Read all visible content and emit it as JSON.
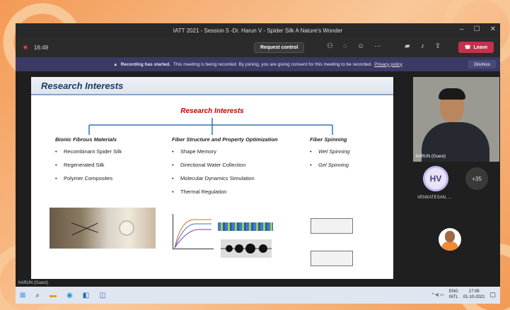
{
  "window": {
    "title": "IATT 2021 - Session 5 -Dr. Harun V - Spider Silk A Nature's Wonder"
  },
  "toolbar": {
    "time": "16:49",
    "request_control": "Request control",
    "leave": "Leave"
  },
  "banner": {
    "bold": "Recording has started.",
    "text": "This meeting is being recorded. By joining, you are giving consent for this meeting to be recorded.",
    "link": "Privacy policy",
    "dismiss": "Dismiss"
  },
  "slide": {
    "header": "Research Interests",
    "center_title": "Research Interests",
    "columns": [
      {
        "title": "Bionic Fibrous Materials",
        "items": [
          "Recombinant Spider Silk",
          "Regenerated Silk",
          "Polymer Composites"
        ]
      },
      {
        "title": "Fiber Structure and Property Optimization",
        "items": [
          "Shape Memory",
          "Directional Water Collection",
          "Molecular Dynamics Simulation",
          "Thermal Regulation"
        ]
      },
      {
        "title": "Fiber Spinning",
        "items": [
          "Wet Spinning",
          "Gel Spinning"
        ]
      }
    ]
  },
  "participants": {
    "video_label": "hARUN (Guest)",
    "hv_initials": "HV",
    "hv_name": "VENKATESAN, ...",
    "more": "+35",
    "presenter_label": "hARUN (Guest)"
  },
  "taskbar": {
    "lang1": "ENG",
    "lang2": "INTL",
    "time": "17:08",
    "date": "01-10-2021"
  },
  "colors": {
    "leave": "#c4314b",
    "banner": "#3b3a64",
    "slide_title": "#1f3864",
    "accent_red": "#c00000"
  }
}
